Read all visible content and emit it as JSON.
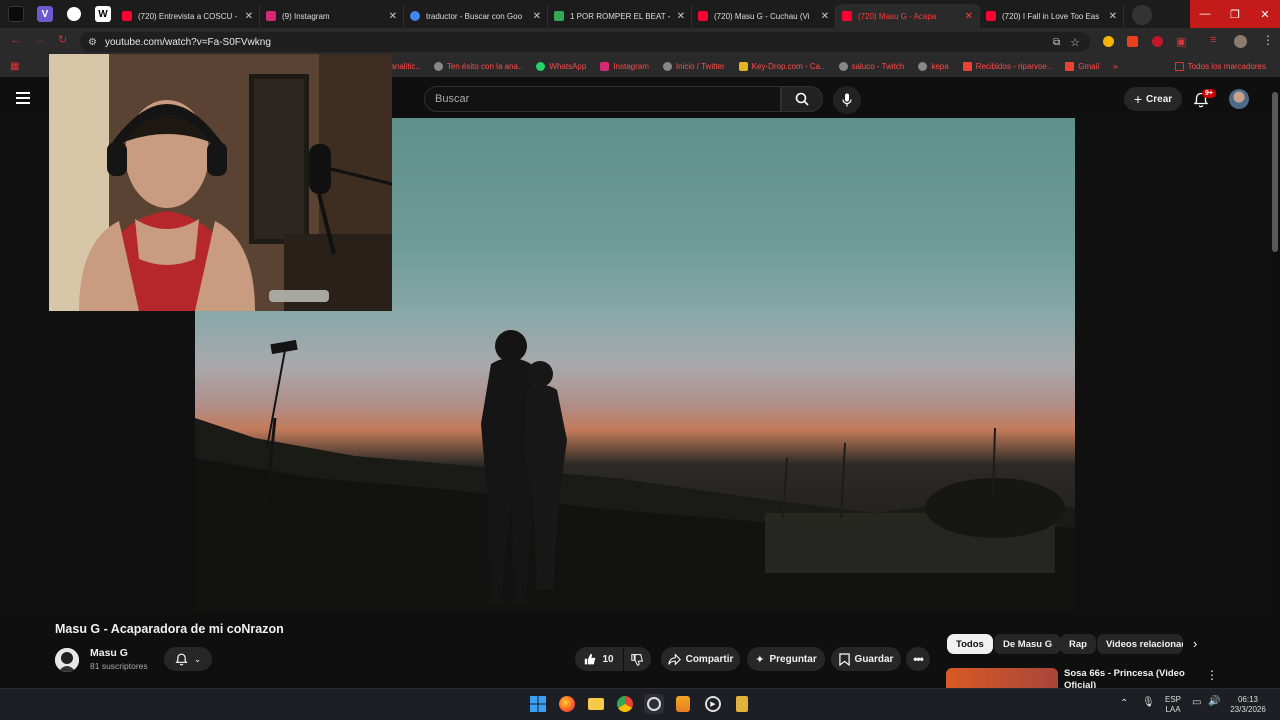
{
  "browser": {
    "pinned_tabs": [
      {
        "label": "",
        "icon": "app-icon",
        "color": "#0b0b0b"
      },
      {
        "label": "V",
        "icon": "v-icon",
        "color": "#6b5bd1"
      },
      {
        "label": "",
        "icon": "globe-icon",
        "color": "#ffffff"
      },
      {
        "label": "W",
        "icon": "w-icon",
        "color": "#ffffff"
      }
    ],
    "tabs": [
      {
        "title": "(720) Entrevista a COSCU -",
        "color": "#ff0033"
      },
      {
        "title": "(9) Instagram",
        "color": "#d62976"
      },
      {
        "title": "traductor - Buscar con Goo",
        "color": "#4285f4"
      },
      {
        "title": "1 POR ROMPER EL BEAT - ",
        "color": "#34a853"
      },
      {
        "title": "(720) Masu G - Cuchau (Vi",
        "color": "#ff0033"
      },
      {
        "title": "(720) Masu G - Acapa",
        "color": "#ff0033"
      },
      {
        "title": "(720) I Fall in Love Too Eas",
        "color": "#ff0033"
      }
    ],
    "url": "youtube.com/watch?v=Fa-S0FVwkng",
    "bookmarks": [
      {
        "label": "tra la analitic..",
        "color": "#888888"
      },
      {
        "label": "Ten éxito con la ana..",
        "color": "#888888"
      },
      {
        "label": "WhatsApp",
        "color": "#25d366"
      },
      {
        "label": "Instagram",
        "color": "#d62976"
      },
      {
        "label": "Inicio / Twitter",
        "color": "#888888"
      },
      {
        "label": "Key-Drop.com - Ca..",
        "color": "#e6b422"
      },
      {
        "label": "saluco - Twitch",
        "color": "#888888"
      },
      {
        "label": "kepa",
        "color": "#888888"
      },
      {
        "label": "Recibidos - riparvoe..",
        "color": "#ea4335"
      },
      {
        "label": "Gmail",
        "color": "#ea4335"
      }
    ],
    "bookmarks_more": "»",
    "all_bookmarks": "Todos los marcadores"
  },
  "youtube": {
    "search_placeholder": "Buscar",
    "create_label": "Crear",
    "notifications_badge": "9+",
    "video_title": "Masu G - Acaparadora de mi coNrazon",
    "channel_name": "Masu G",
    "subscribers": "81 suscriptores",
    "like_count": "10",
    "share_label": "Compartir",
    "ask_label": "Preguntar",
    "save_label": "Guardar",
    "chips": [
      "Todos",
      "De Masu G",
      "Rap",
      "Videos relacionad"
    ],
    "recommended_title": "Sosa 66s - Princesa (Video Oficial)"
  },
  "taskbar": {
    "language_top": "ESP",
    "language_bottom": "LAA",
    "time": "06:13",
    "date": "23/3/2026"
  }
}
